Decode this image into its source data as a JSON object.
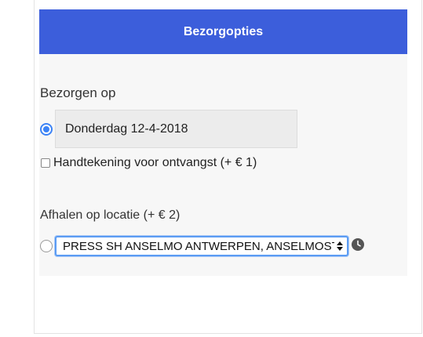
{
  "header": {
    "title": "Bezorgopties"
  },
  "delivery": {
    "label": "Bezorgen op",
    "date_value": "Donderdag 12-4-2018",
    "signature_label": "Handtekening voor ontvangst  (+ € 1)"
  },
  "pickup": {
    "label": "Afhalen op locatie (+ € 2)",
    "selected_location": "PRESS SH ANSELMO ANTWERPEN, ANSELMOSTRAAT"
  },
  "colors": {
    "header_bg": "#3c5edb",
    "accent": "#3c83f6"
  },
  "icons": {
    "clock": "clock-icon",
    "select_arrows": "chevron-updown-icon"
  }
}
